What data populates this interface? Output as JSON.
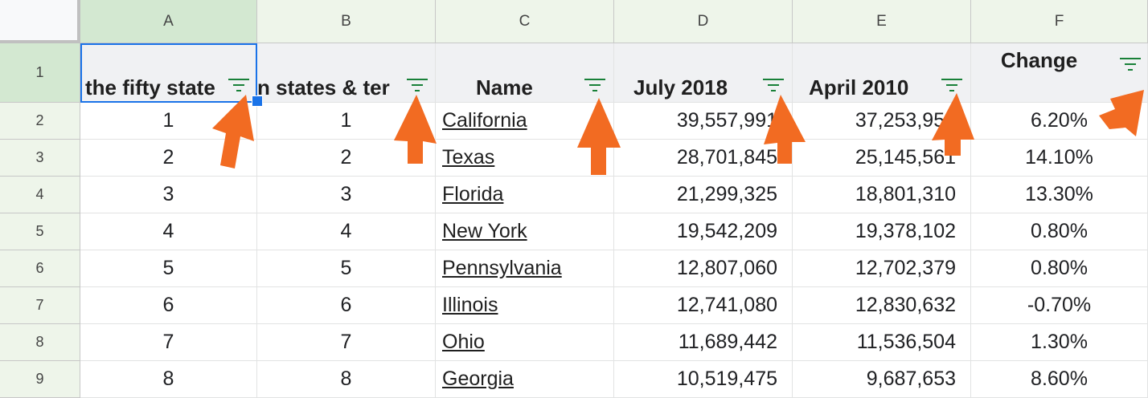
{
  "columns": [
    "A",
    "B",
    "C",
    "D",
    "E",
    "F"
  ],
  "rows": [
    "1",
    "2",
    "3",
    "4",
    "5",
    "6",
    "7",
    "8",
    "9"
  ],
  "headers": [
    "the fifty state",
    "n states & ter",
    "Name",
    "July 2018",
    "April 2010",
    "Change"
  ],
  "data": [
    [
      "1",
      "1",
      "California",
      "39,557,991",
      "37,253,956",
      "6.20%"
    ],
    [
      "2",
      "2",
      "Texas",
      "28,701,845",
      "25,145,561",
      "14.10%"
    ],
    [
      "3",
      "3",
      "Florida",
      "21,299,325",
      "18,801,310",
      "13.30%"
    ],
    [
      "4",
      "4",
      "New York",
      "19,542,209",
      "19,378,102",
      "0.80%"
    ],
    [
      "5",
      "5",
      "Pennsylvania",
      "12,807,060",
      "12,702,379",
      "0.80%"
    ],
    [
      "6",
      "6",
      "Illinois",
      "12,741,080",
      "12,830,632",
      "-0.70%"
    ],
    [
      "7",
      "7",
      "Ohio",
      "11,689,442",
      "11,536,504",
      "1.30%"
    ],
    [
      "8",
      "8",
      "Georgia",
      "10,519,475",
      "9,687,653",
      "8.60%"
    ]
  ],
  "icons": {
    "filter": "filter-icon",
    "arrow": "arrow-annotation-icon"
  },
  "colors": {
    "accent": "#1a73e8",
    "filter": "#188038",
    "arrow": "#f26b22",
    "header_bg": "#eef5ea"
  }
}
